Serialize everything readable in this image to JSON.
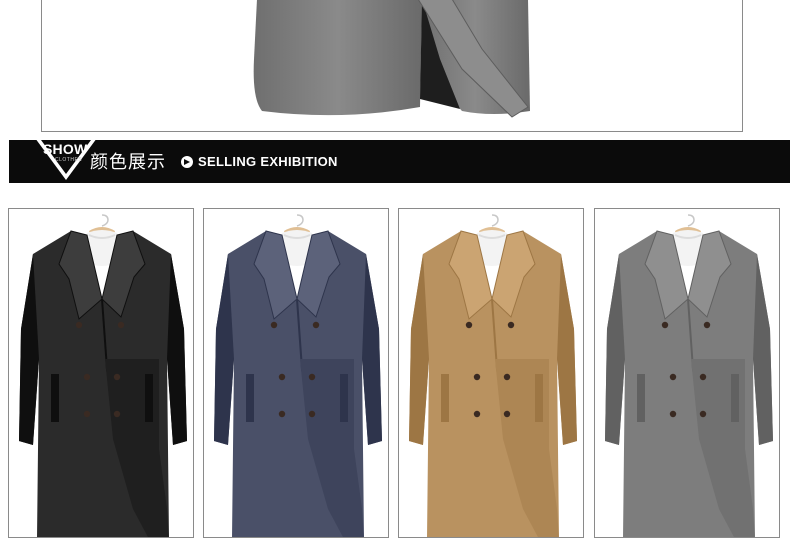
{
  "banner": {
    "badge_title": "SHOW",
    "badge_subtitle": "CLOTHES",
    "title_cn": "颜色展示",
    "title_en": "SELLING EXHIBITION"
  },
  "icons": {
    "arrow": "arrow-right-circle-icon",
    "hanger": "hanger-icon"
  },
  "colors": {
    "banner_bg": "#0b0b0b",
    "coat_top": "#7a7a7a",
    "coat_colors": [
      "#2b2b2b",
      "#4a5068",
      "#b99260",
      "#7d7d7d"
    ]
  },
  "swatches": [
    {
      "color": "#2b2b2b"
    },
    {
      "color": "#4a5068"
    },
    {
      "color": "#b99260"
    },
    {
      "color": "#7d7d7d"
    }
  ]
}
